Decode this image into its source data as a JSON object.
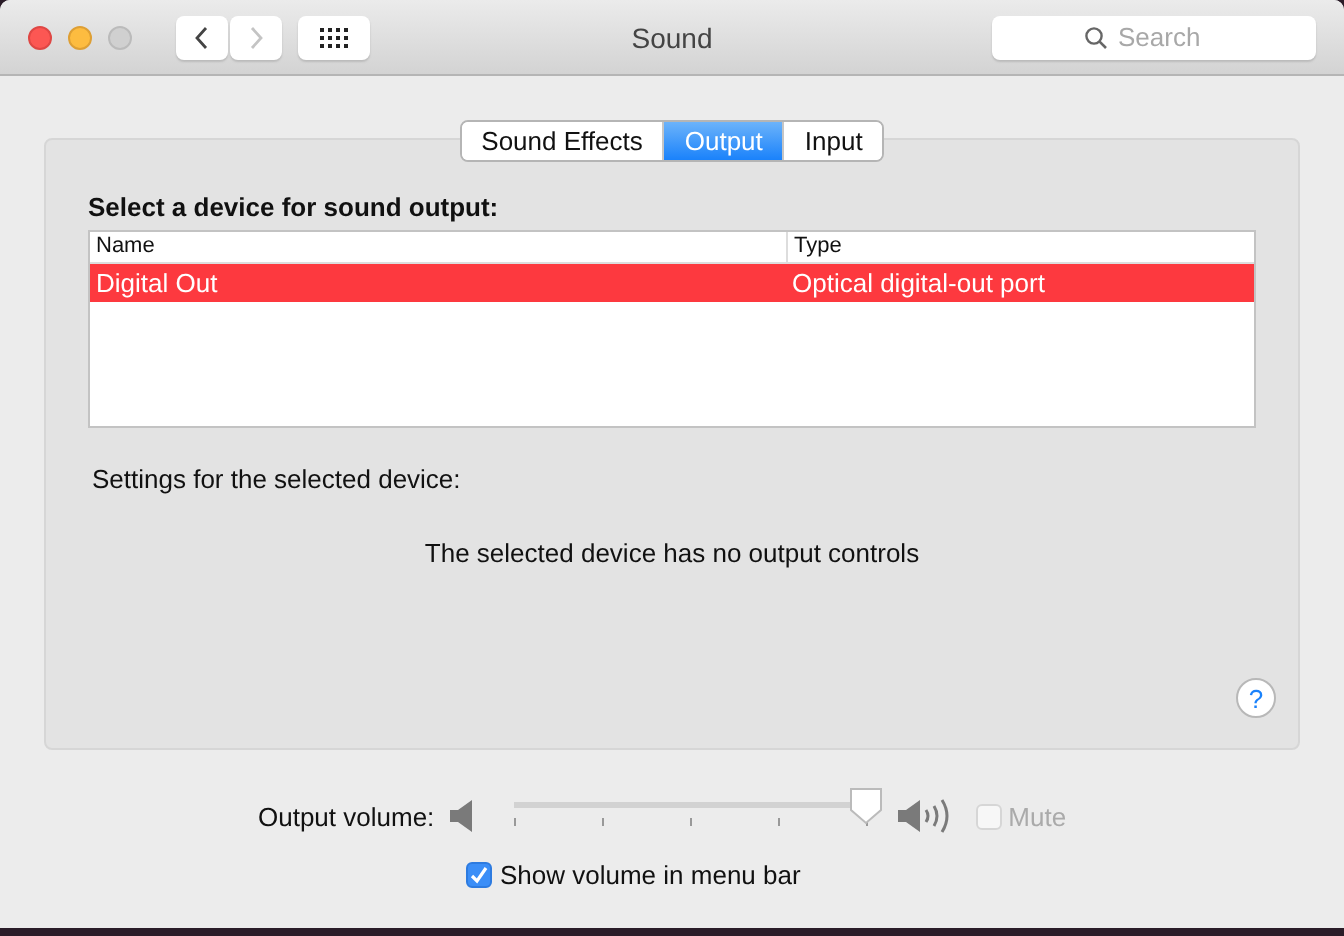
{
  "window": {
    "title": "Sound"
  },
  "search": {
    "placeholder": "Search"
  },
  "tabs": [
    {
      "label": "Sound Effects",
      "selected": false
    },
    {
      "label": "Output",
      "selected": true
    },
    {
      "label": "Input",
      "selected": false
    }
  ],
  "heading": "Select a device for sound output:",
  "table": {
    "columns": [
      "Name",
      "Type"
    ],
    "rows": [
      {
        "cells": [
          "Digital Out",
          "Optical digital-out port"
        ],
        "selected": true
      }
    ]
  },
  "settings_label": "Settings for the selected device:",
  "message": "The selected device has no output controls",
  "help": "?",
  "volume": {
    "label": "Output volume:",
    "level": 1.0
  },
  "mute": {
    "label": "Mute",
    "checked": false,
    "disabled": true
  },
  "show_in_menu_bar": {
    "label": "Show volume in menu bar",
    "checked": true
  }
}
